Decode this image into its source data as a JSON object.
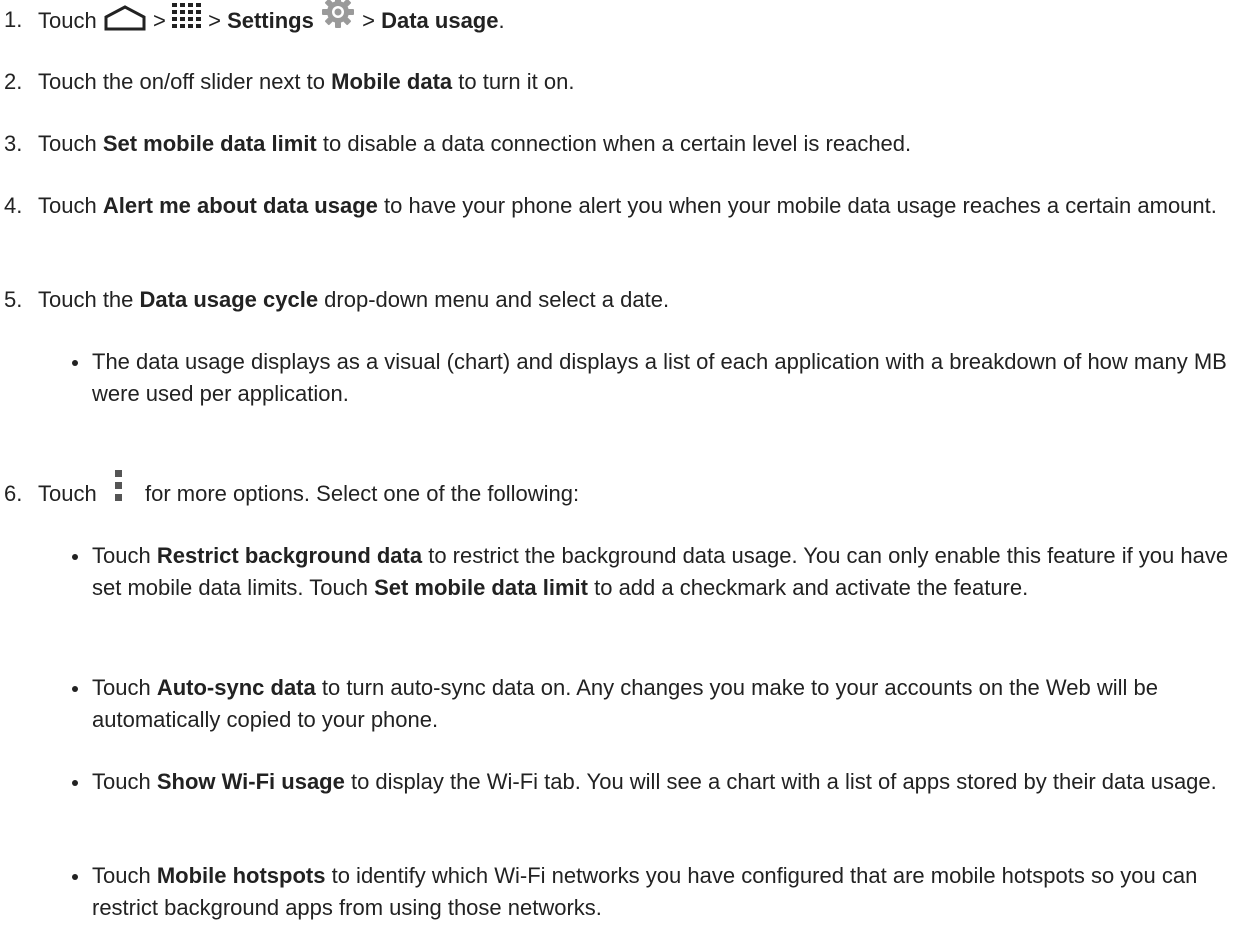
{
  "steps": [
    {
      "num": "1.",
      "w1": "Touch",
      "sep1": ">",
      "sep2": ">",
      "b1": "Settings",
      "sep3": ">",
      "b2": "Data usage",
      "end": ".",
      "icons": [
        "home-icon",
        "apps-grid-icon",
        "settings-gear-icon"
      ]
    },
    {
      "num": "2.",
      "t1": "Touch the on/off slider next to ",
      "b1": "Mobile data",
      "t2": " to turn it on."
    },
    {
      "num": "3.",
      "t1": "Touch ",
      "b1": "Set mobile data limit",
      "t2": " to disable a data connection when a certain level is reached."
    },
    {
      "num": "4.",
      "t1": "Touch ",
      "b1": "Alert me about data usage",
      "t2": " to have your phone alert you when your mobile data usage reaches a certain amount."
    },
    {
      "num": "5.",
      "t1": "Touch the ",
      "b1": "Data usage cycle",
      "t2": " drop-down menu and select a date.",
      "bullets": [
        {
          "t1": "The data usage displays as a visual (chart) and displays a list of each application with a breakdown of how many MB were used per application."
        }
      ]
    },
    {
      "num": "6.",
      "t1": "Touch",
      "t2": "for more options. Select one of the following:",
      "icons": [
        "more-options-icon"
      ],
      "bullets": [
        {
          "t1": "Touch ",
          "b1": "Restrict background data",
          "t2": " to restrict the background data usage. You can only enable this feature if you have set mobile data limits. Touch ",
          "b2": "Set mobile data limit",
          "t3": " to add a checkmark and activate the feature."
        },
        {
          "t1": "Touch ",
          "b1": "Auto-sync data",
          "t2": " to turn auto-sync data on. Any changes you make to your accounts on the Web will be automatically copied to your phone."
        },
        {
          "t1": "Touch ",
          "b1": "Show Wi-Fi usage",
          "t2": " to display the Wi-Fi tab. You will see a chart with a list of apps stored by their data usage."
        },
        {
          "t1": "Touch ",
          "b1": "Mobile hotspots",
          "t2": " to identify which Wi-Fi networks you have configured that are mobile hotspots so you can restrict background apps from using those networks."
        }
      ]
    }
  ]
}
